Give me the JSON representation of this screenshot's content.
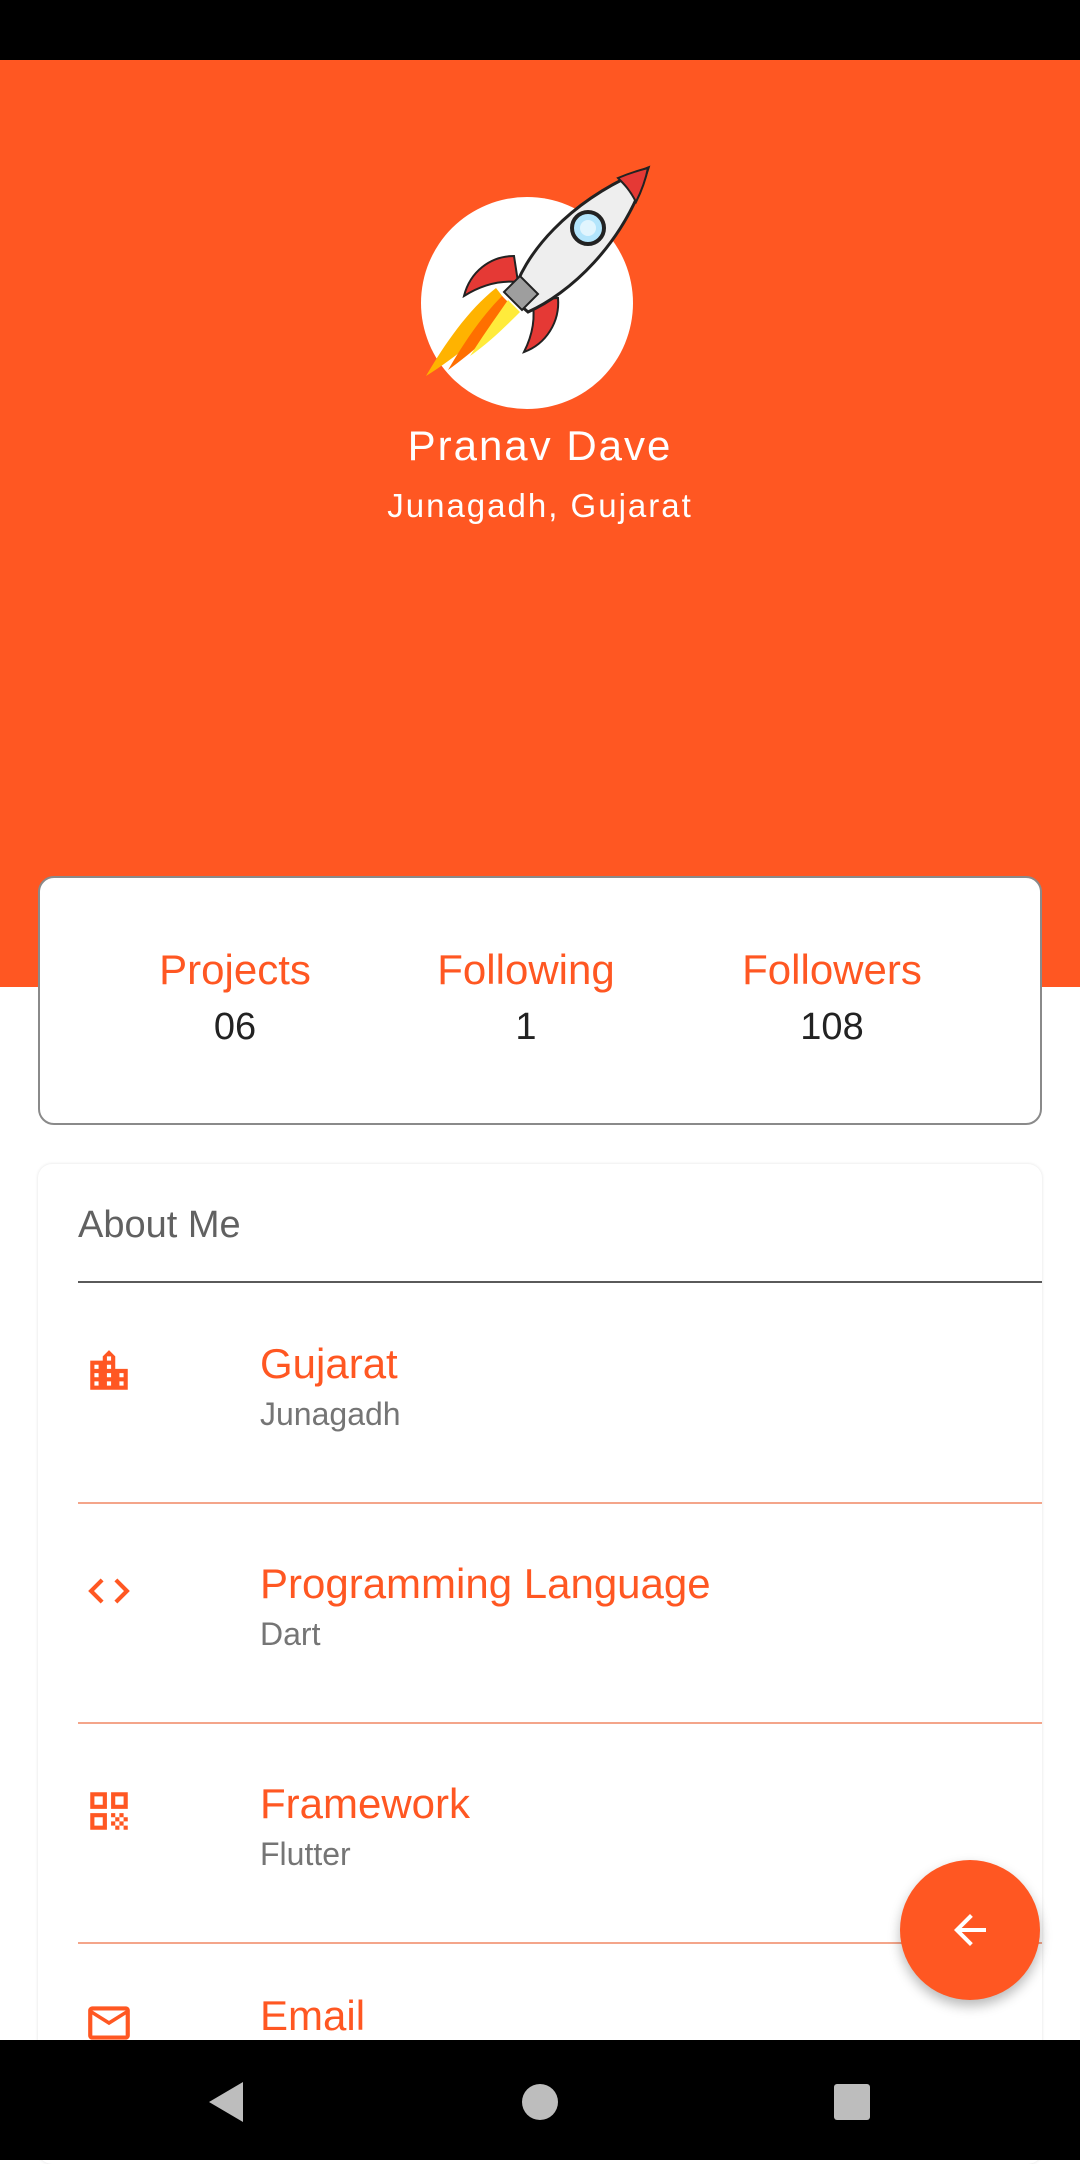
{
  "colors": {
    "accent": "#FF5722",
    "divider": "#F4A58A"
  },
  "profile": {
    "avatar_icon": "rocket-icon",
    "name": "Pranav Dave",
    "location": "Junagadh, Gujarat"
  },
  "stats": [
    {
      "label": "Projects",
      "value": "06"
    },
    {
      "label": "Following",
      "value": "1"
    },
    {
      "label": "Followers",
      "value": "108"
    }
  ],
  "about": {
    "title": "About Me",
    "items": [
      {
        "icon": "city-icon",
        "title": "Gujarat",
        "subtitle": "Junagadh"
      },
      {
        "icon": "code-icon",
        "title": "Programming Language",
        "subtitle": "Dart"
      },
      {
        "icon": "qr-code-icon",
        "title": "Framework",
        "subtitle": "Flutter"
      },
      {
        "icon": "email-icon",
        "title": "Email",
        "subtitle": ""
      }
    ]
  },
  "fab": {
    "icon": "arrow-back-icon"
  },
  "navbar": {
    "icons": [
      "back-triangle-icon",
      "home-circle-icon",
      "recents-square-icon"
    ]
  }
}
